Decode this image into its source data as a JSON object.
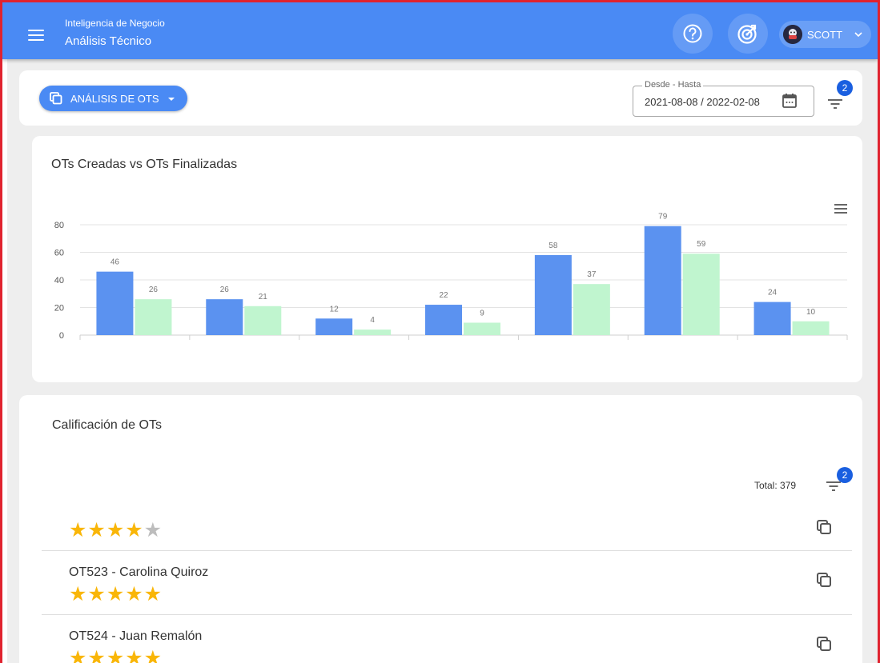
{
  "header": {
    "subtitle": "Inteligencia de Negocio",
    "title": "Análisis Técnico",
    "user_name": "SCOTT"
  },
  "toolbar": {
    "analysis_button_label": "ANÁLISIS DE OTS",
    "date_range_legend": "Desde - Hasta",
    "date_range_value": "2021-08-08 / 2022-02-08",
    "filter_badge_count": "2"
  },
  "chart_card": {
    "title": "OTs Creadas vs OTs Finalizadas"
  },
  "chart_data": {
    "type": "bar",
    "title": "OTs Creadas vs OTs Finalizadas",
    "categories": [
      "",
      "",
      "",
      "",
      "",
      "",
      ""
    ],
    "series": [
      {
        "values": [
          46,
          26,
          12,
          22,
          58,
          79,
          24
        ],
        "color": "#5b92f0"
      },
      {
        "values": [
          26,
          21,
          4,
          9,
          37,
          59,
          10
        ],
        "color": "#c0f5cf"
      }
    ],
    "yticks": [
      "0",
      "20",
      "40",
      "60",
      "80"
    ],
    "ylim": [
      0,
      80
    ],
    "grid": true,
    "data_labels": true,
    "legend": "none"
  },
  "rating_card": {
    "title": "Calificación de OTs",
    "total_label": "Total: 379",
    "filter_badge_count": "2",
    "items": [
      {
        "name": "",
        "rating": 4
      },
      {
        "name": "OT523 - Carolina Quiroz",
        "rating": 5
      },
      {
        "name": "OT524 - Juan Remalón",
        "rating": 5
      }
    ]
  },
  "colors": {
    "header_bg": "#4a8af4",
    "accent": "#4a8af4",
    "badge": "#1a5fe0",
    "star": "#f9b608",
    "star_empty": "#bdbdbd",
    "frame": "#e0232f"
  }
}
